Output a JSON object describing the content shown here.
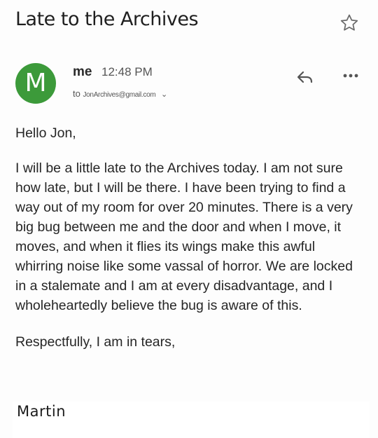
{
  "email": {
    "subject": "Late to the Archives",
    "icons": {
      "star": "star-outline-icon",
      "reply": "reply-arrow-icon",
      "more": "more-horizontal-icon",
      "recipient_expand": "chevron-down-icon"
    },
    "sender": {
      "avatar_letter": "M",
      "avatar_color": "#3c9a3a",
      "name": "me",
      "time": "12:48 PM",
      "recipient_prefix": "to",
      "recipient_address": "JonArchives@gmail.com",
      "chevron": "⌄"
    },
    "body": {
      "greeting": "Hello Jon,",
      "paragraph": "I will be a little late to the Archives today. I am not sure how late, but I will be there. I have been trying to find a way out of my room for over 20 minutes. There is a very big bug between me and the door and when I move, it moves, and when it flies its wings make this awful whirring noise like some vassal of horror. We are locked in a stalemate and I am at every disadvantage, and I wholeheartedly believe the bug is aware of this.",
      "signoff": "Respectfully, I am in tears,",
      "signature": "Martin"
    }
  }
}
